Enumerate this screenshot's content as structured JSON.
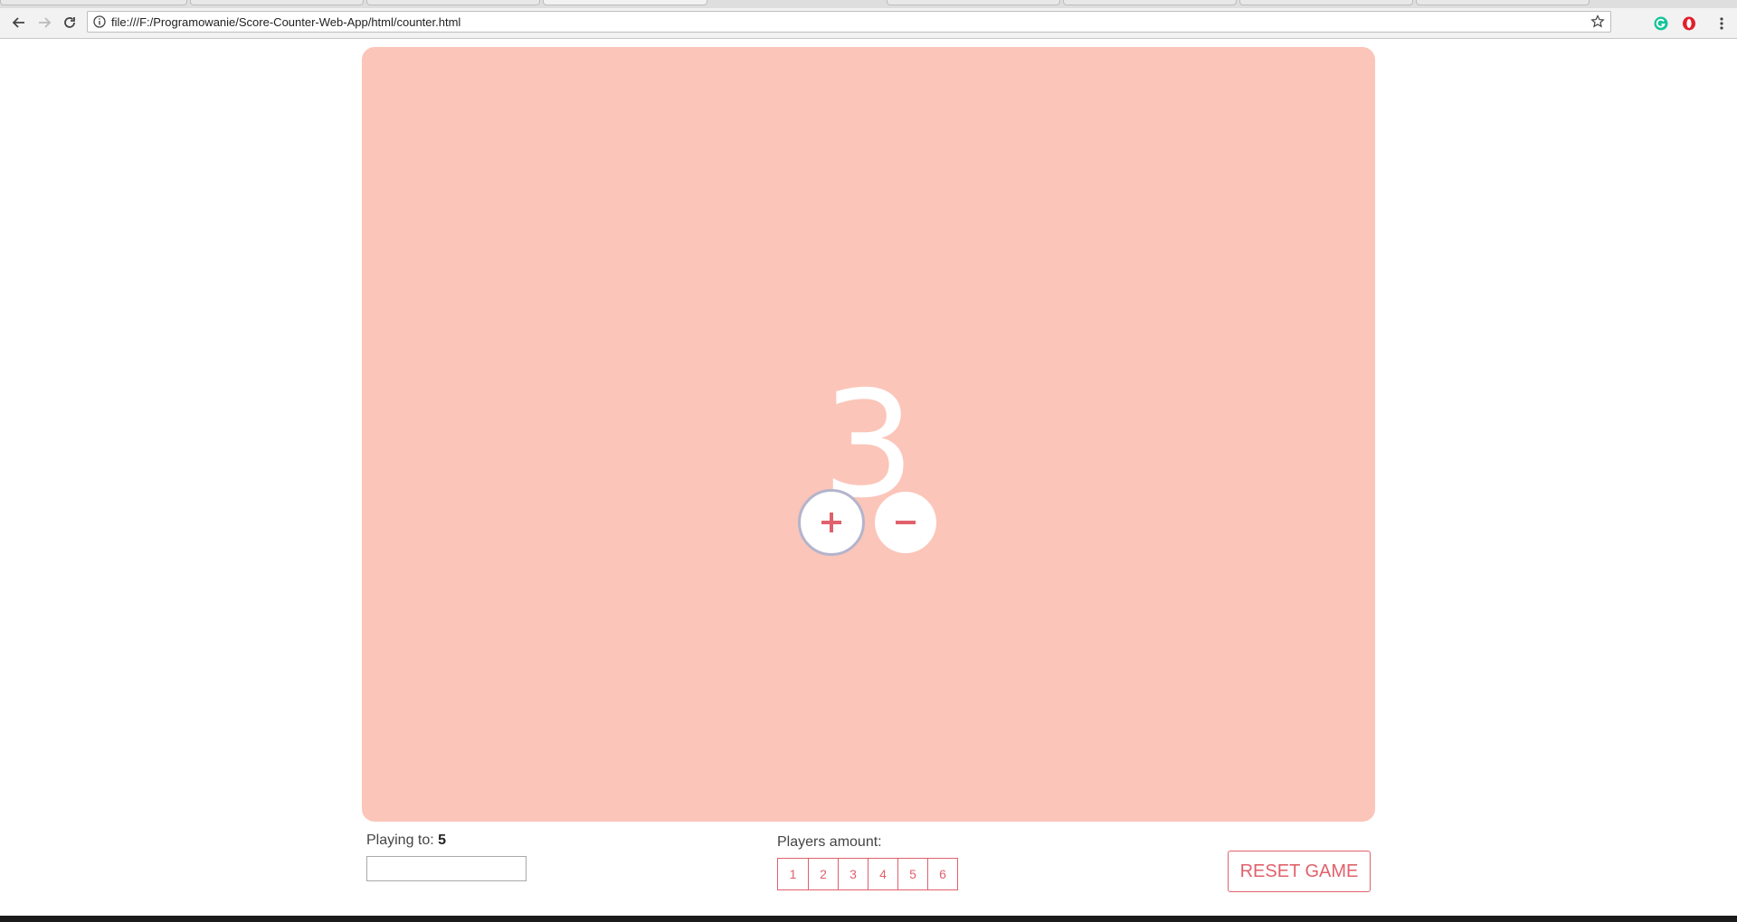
{
  "browser": {
    "url": "file:///F:/Programowanie/Score-Counter-Web-App/html/counter.html",
    "icons": {
      "back": "arrow-left-icon",
      "forward": "arrow-right-icon",
      "reload": "reload-icon",
      "info": "info-icon",
      "bookmark": "star-icon",
      "extension_1": "grammarly-icon",
      "extension_2": "opera-icon",
      "menu": "kebab-menu-icon"
    }
  },
  "counter": {
    "score": "3",
    "increment_label": "+",
    "decrement_label": "−",
    "colors": {
      "panel": "#fbc5b9",
      "accent": "#e0616c",
      "score_text": "#ffffff"
    }
  },
  "settings": {
    "playing_to_label": "Playing to:",
    "playing_to_value": "5",
    "playing_to_input_value": "",
    "players_label": "Players amount:",
    "players_options": [
      "1",
      "2",
      "3",
      "4",
      "5",
      "6"
    ],
    "reset_label": "RESET GAME"
  }
}
